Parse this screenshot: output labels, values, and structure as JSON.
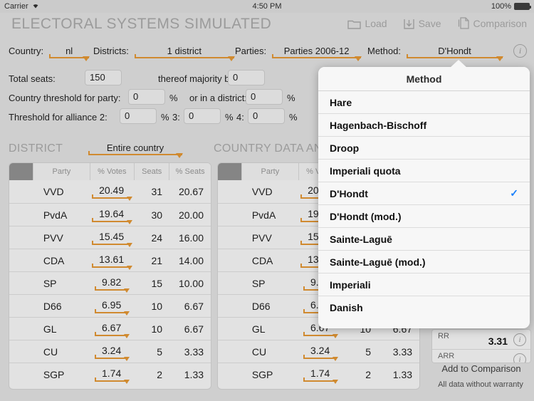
{
  "statusbar": {
    "carrier": "Carrier",
    "time": "4:50 PM",
    "battery": "100%"
  },
  "header": {
    "title": "ELECTORAL SYSTEMS SIMULATED",
    "buttons": [
      {
        "label": "Load",
        "icon": "folder-icon"
      },
      {
        "label": "Save",
        "icon": "download-icon"
      },
      {
        "label": "Comparison",
        "icon": "documents-icon"
      }
    ]
  },
  "filters": [
    {
      "label": "Country:",
      "value": "nl"
    },
    {
      "label": "Districts:",
      "value": "1 district"
    },
    {
      "label": "Parties:",
      "value": "Parties 2006-12"
    },
    {
      "label": "Method:",
      "value": "D'Hondt"
    }
  ],
  "params": {
    "total_seats_label": "Total seats:",
    "total_seats_value": "150",
    "majority_bonus_label": "thereof majority bonus:",
    "majority_bonus_value": "0",
    "country_threshold_label": "Country threshold for party:",
    "country_threshold_value": "0",
    "district_threshold_label": "or in a district:",
    "district_threshold_value": "0",
    "alliance_label": "Threshold for alliance 2:",
    "alliance2_value": "0",
    "alliance3_label": "3:",
    "alliance3_value": "0",
    "alliance4_label": "4:",
    "alliance4_value": "0",
    "percent": "%"
  },
  "sections": {
    "district_title": "DISTRICT",
    "district_selector": "Entire country",
    "country_title": "COUNTRY DATA AND R"
  },
  "table": {
    "columns": [
      "Party",
      "% Votes",
      "Seats",
      "% Seats"
    ],
    "rows": [
      {
        "party": "VVD",
        "votes": "20.49",
        "seats": "31",
        "pct_seats": "20.67"
      },
      {
        "party": "PvdA",
        "votes": "19.64",
        "seats": "30",
        "pct_seats": "20.00"
      },
      {
        "party": "PVV",
        "votes": "15.45",
        "seats": "24",
        "pct_seats": "16.00"
      },
      {
        "party": "CDA",
        "votes": "13.61",
        "seats": "21",
        "pct_seats": "14.00"
      },
      {
        "party": "SP",
        "votes": "9.82",
        "seats": "15",
        "pct_seats": "10.00"
      },
      {
        "party": "D66",
        "votes": "6.95",
        "seats": "10",
        "pct_seats": "6.67"
      },
      {
        "party": "GL",
        "votes": "6.67",
        "seats": "10",
        "pct_seats": "6.67"
      },
      {
        "party": "CU",
        "votes": "3.24",
        "seats": "5",
        "pct_seats": "3.33"
      },
      {
        "party": "SGP",
        "votes": "1.74",
        "seats": "2",
        "pct_seats": "1.33"
      }
    ]
  },
  "metrics": {
    "rows": [
      {
        "name": "RR",
        "value": "3.31"
      },
      {
        "name": "ARR",
        "value": ""
      }
    ],
    "add_to_comparison": "Add to Comparison",
    "warranty": "All data without warranty"
  },
  "popover": {
    "title": "Method",
    "selected": "D'Hondt",
    "items": [
      "Hare",
      "Hagenbach-Bischoff",
      "Droop",
      "Imperiali quota",
      "D'Hondt",
      "D'Hondt (mod.)",
      "Sainte-Laguē",
      "Sainte-Laguē (mod.)",
      "Imperiali",
      "Danish"
    ]
  },
  "colors": {
    "accent": "#d08a30",
    "check": "#157efb",
    "background": "#cfcfcf"
  }
}
